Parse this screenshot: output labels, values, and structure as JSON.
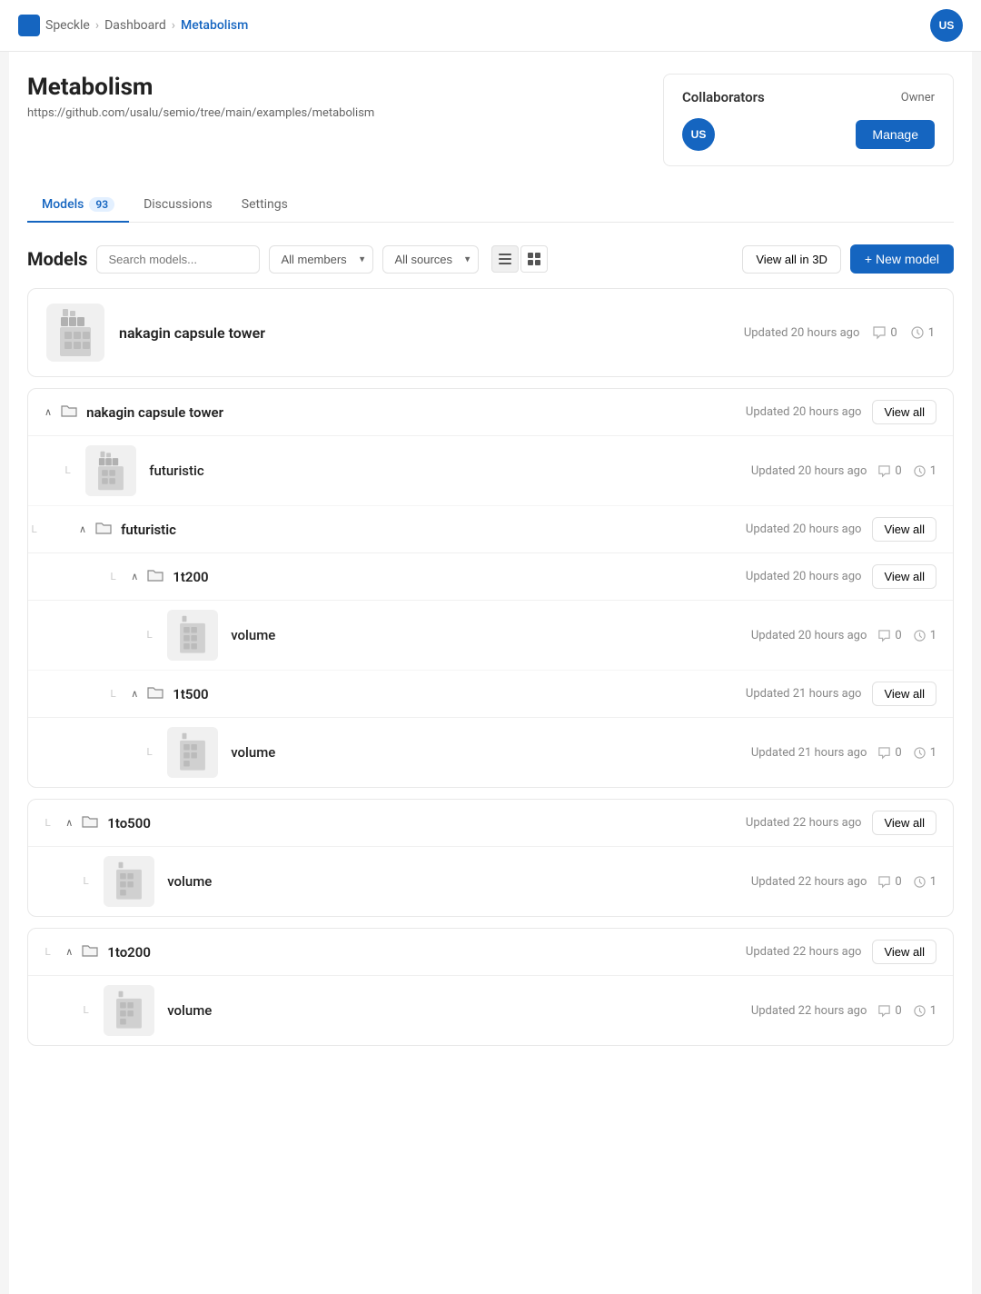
{
  "topbar": {
    "breadcrumb": {
      "logo_alt": "Speckle",
      "steps": [
        "Speckle",
        "Dashboard",
        "Metabolism"
      ],
      "separators": [
        ">",
        ">"
      ]
    },
    "user_initials": "US"
  },
  "project": {
    "title": "Metabolism",
    "url": "https://github.com/usalu/semio/tree/main/examples/metabolism"
  },
  "collaborators": {
    "title": "Collaborators",
    "role": "Owner",
    "user_initials": "US",
    "manage_label": "Manage"
  },
  "tabs": [
    {
      "label": "Models",
      "badge": "93",
      "active": true
    },
    {
      "label": "Discussions",
      "badge": null,
      "active": false
    },
    {
      "label": "Settings",
      "badge": null,
      "active": false
    }
  ],
  "models_section": {
    "title": "Models",
    "search_placeholder": "Search models...",
    "filter_members": "All members",
    "filter_sources": "All sources",
    "view_all_3d_label": "View all in 3D",
    "new_model_label": "+ New model"
  },
  "models": [
    {
      "id": "nakagin-top",
      "name": "nakagin capsule tower",
      "updated": "Updated 20 hours ago",
      "comments": "0",
      "versions": "1",
      "has_thumbnail": true
    }
  ],
  "folders": [
    {
      "id": "nakagin-folder",
      "name": "nakagin capsule tower",
      "updated": "Updated 20 hours ago",
      "show_view_all": true,
      "subfolders": [
        {
          "id": "futuristic-item",
          "name": "futuristic",
          "updated": "Updated 20 hours ago",
          "comments": "0",
          "versions": "1",
          "has_thumbnail": true,
          "subfolder": {
            "id": "futuristic-folder",
            "name": "futuristic",
            "updated": "Updated 20 hours ago",
            "show_view_all": true,
            "children": [
              {
                "id": "1t200-folder",
                "name": "1t200",
                "updated": "Updated 20 hours ago",
                "show_view_all": true,
                "items": [
                  {
                    "name": "volume",
                    "updated": "Updated 20 hours ago",
                    "comments": "0",
                    "versions": "1"
                  }
                ]
              },
              {
                "id": "1t500-folder",
                "name": "1t500",
                "updated": "Updated 21 hours ago",
                "show_view_all": true,
                "items": [
                  {
                    "name": "volume",
                    "updated": "Updated 21 hours ago",
                    "comments": "0",
                    "versions": "1"
                  }
                ]
              }
            ]
          }
        }
      ]
    },
    {
      "id": "1to500-folder",
      "name": "1to500",
      "updated": "Updated 22 hours ago",
      "show_view_all": true,
      "items": [
        {
          "name": "volume",
          "updated": "Updated 22 hours ago",
          "comments": "0",
          "versions": "1"
        }
      ]
    },
    {
      "id": "1to200-folder",
      "name": "1to200",
      "updated": "Updated 22 hours ago",
      "show_view_all": true,
      "items": [
        {
          "name": "volume",
          "updated": "Updated 22 hours ago",
          "comments": "0",
          "versions": "1"
        }
      ]
    }
  ]
}
